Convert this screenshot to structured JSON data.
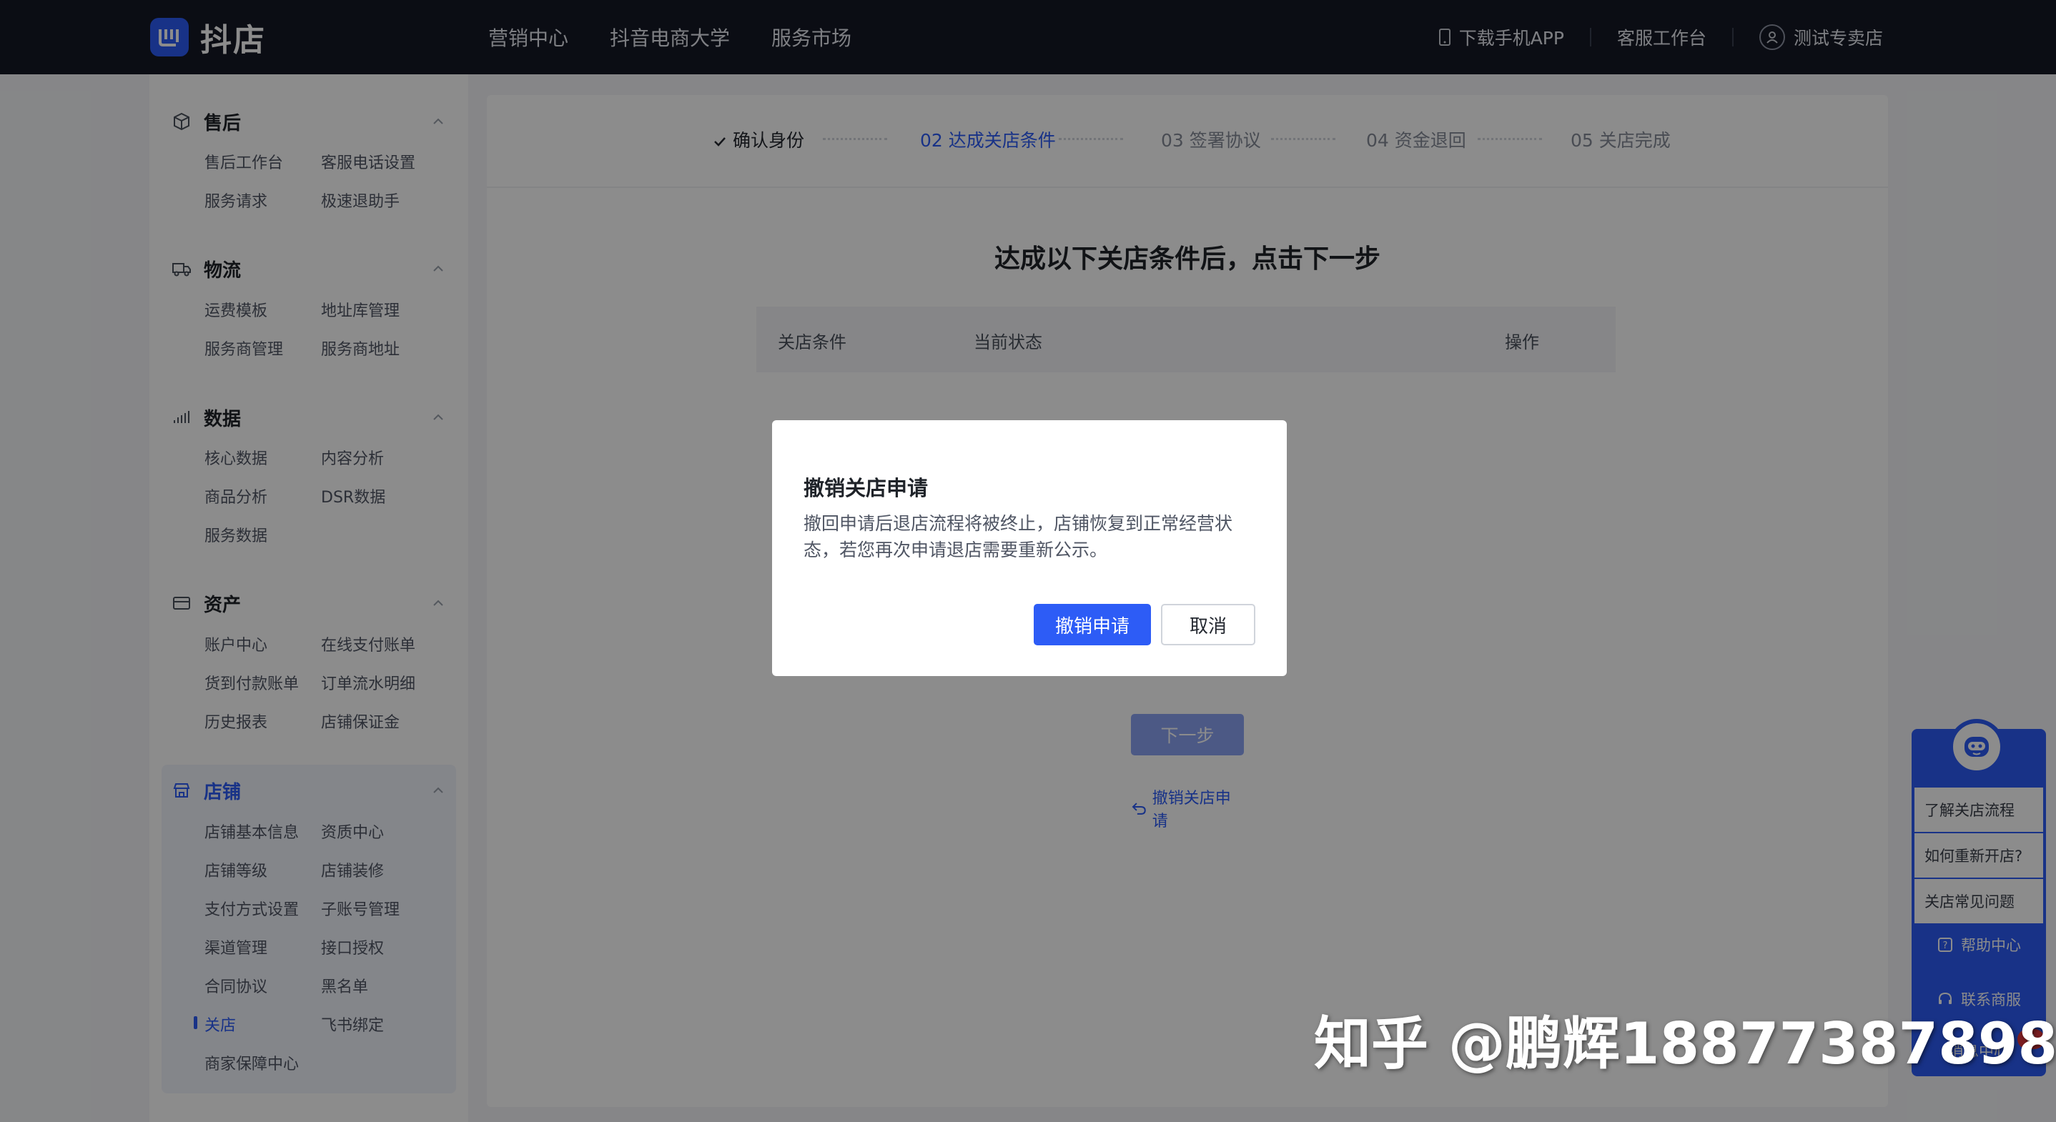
{
  "brand": {
    "name": "抖店",
    "color": "#2d5cf6"
  },
  "topnav": [
    "营销中心",
    "抖音电商大学",
    "服务市场"
  ],
  "topright": {
    "download": "下载手机APP",
    "service": "客服工作台",
    "shop": "测试专卖店"
  },
  "sidebar": {
    "groups": [
      {
        "title": "售后",
        "icon": "box-icon",
        "items": [
          "售后工作台",
          "客服电话设置",
          "服务请求",
          "极速退助手"
        ]
      },
      {
        "title": "物流",
        "icon": "truck-icon",
        "items": [
          "运费模板",
          "地址库管理",
          "服务商管理",
          "服务商地址"
        ]
      },
      {
        "title": "数据",
        "icon": "bar-chart-icon",
        "items": [
          "核心数据",
          "内容分析",
          "商品分析",
          "DSR数据",
          "服务数据"
        ]
      },
      {
        "title": "资产",
        "icon": "wallet-icon",
        "items": [
          "账户中心",
          "在线支付账单",
          "货到付款账单",
          "订单流水明细",
          "历史报表",
          "店铺保证金"
        ]
      },
      {
        "title": "店铺",
        "icon": "store-icon",
        "items": [
          "店铺基本信息",
          "资质中心",
          "店铺等级",
          "店铺装修",
          "支付方式设置",
          "子账号管理",
          "渠道管理",
          "接口授权",
          "合同协议",
          "黑名单",
          "关店",
          "飞书绑定",
          "商家保障中心"
        ]
      }
    ]
  },
  "steps": [
    {
      "label": "确认身份",
      "state": "done"
    },
    {
      "label": "02 达成关店条件",
      "state": "current"
    },
    {
      "label": "03 签署协议",
      "state": "todo"
    },
    {
      "label": "04 资金退回",
      "state": "todo"
    },
    {
      "label": "05 关店完成",
      "state": "todo"
    }
  ],
  "main": {
    "heading": "达成以下关店条件后，点击下一步",
    "columns": [
      "关店条件",
      "当前状态",
      "操作"
    ],
    "next_button": "下一步",
    "revoke_link": "撤销关店申请"
  },
  "dialog": {
    "title": "撤销关店申请",
    "body": "撤回申请后退店流程将被终止，店铺恢复到正常经营状态，若您再次申请退店需要重新公示。",
    "confirm": "撤销申请",
    "cancel": "取消"
  },
  "widget": {
    "questions": [
      "了解关店流程",
      "如何重新开店?",
      "关店常见问题"
    ],
    "help": "帮助中心",
    "contact": "联系商服",
    "message": "消息中心",
    "badge": "8"
  },
  "watermark": "知乎 @鹏辉18877387898"
}
